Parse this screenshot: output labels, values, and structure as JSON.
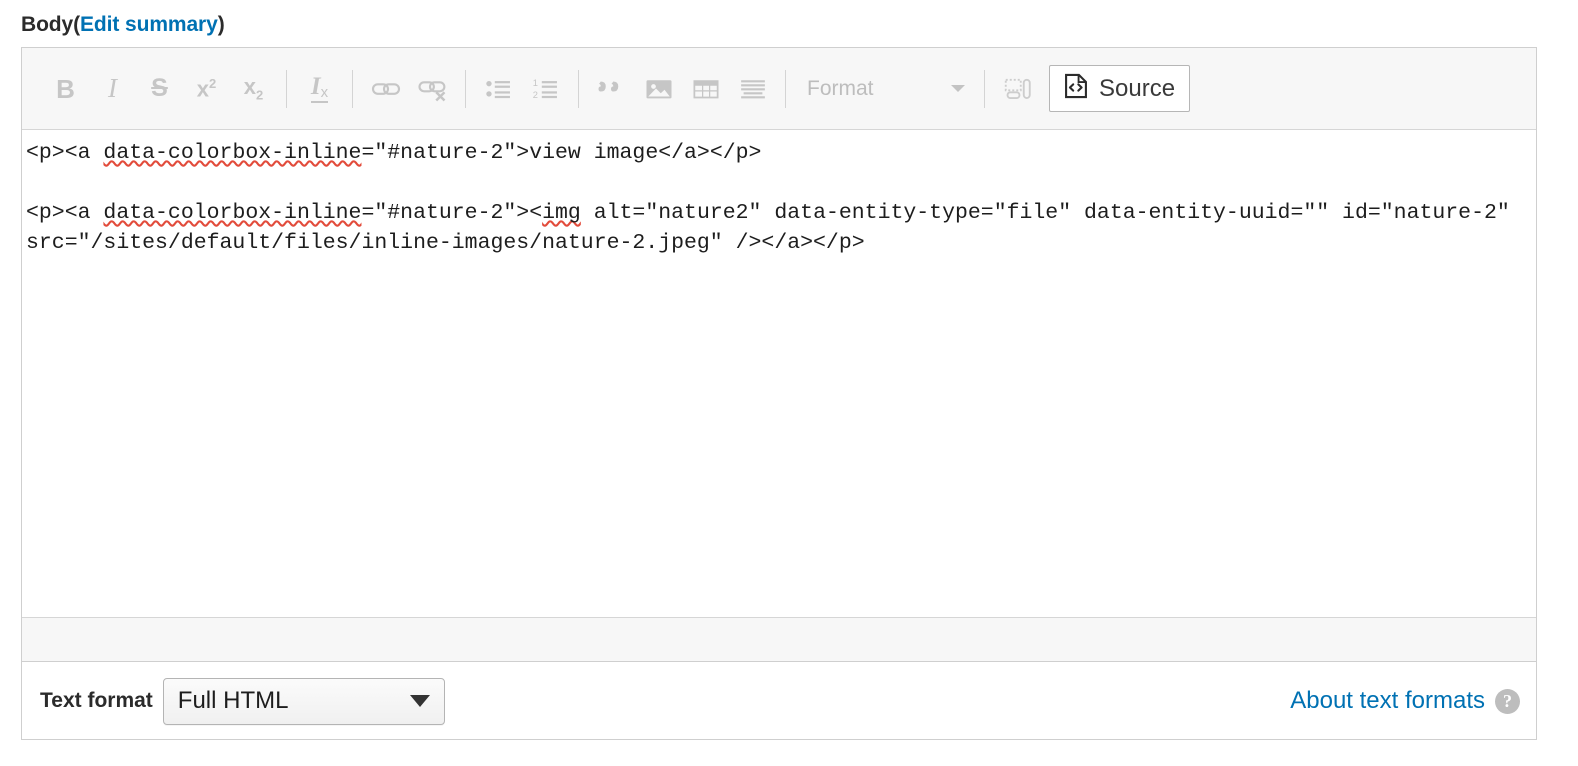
{
  "field": {
    "label_prefix": "Body",
    "paren_open": "(",
    "edit_summary_link": "Edit summary",
    "paren_close": ")"
  },
  "toolbar": {
    "buttons": [
      {
        "name": "bold",
        "label": "B",
        "icon": "bold-icon"
      },
      {
        "name": "italic",
        "label": "I",
        "icon": "italic-icon"
      },
      {
        "name": "strikethrough",
        "label": "S",
        "icon": "strikethrough-icon"
      },
      {
        "name": "superscript",
        "label": "x",
        "sup": "2",
        "icon": "superscript-icon"
      },
      {
        "name": "subscript",
        "label": "x",
        "sub": "2",
        "icon": "subscript-icon"
      },
      {
        "name": "remove-format",
        "label": "I",
        "sub": "x",
        "icon": "remove-format-icon"
      },
      {
        "name": "link",
        "label": "",
        "icon": "link-icon"
      },
      {
        "name": "unlink",
        "label": "",
        "icon": "unlink-icon"
      },
      {
        "name": "bulleted-list",
        "label": "",
        "icon": "bulleted-list-icon"
      },
      {
        "name": "numbered-list",
        "label": "",
        "icon": "numbered-list-icon"
      },
      {
        "name": "blockquote",
        "label": "",
        "icon": "blockquote-icon"
      },
      {
        "name": "image",
        "label": "",
        "icon": "image-icon"
      },
      {
        "name": "table",
        "label": "",
        "icon": "table-icon"
      },
      {
        "name": "horizontal-rule",
        "label": "",
        "icon": "horizontal-rule-icon"
      },
      {
        "name": "templates",
        "label": "",
        "icon": "templates-icon"
      }
    ],
    "format_dropdown": {
      "label": "Format",
      "selected": ""
    },
    "source_button": {
      "label": "Source",
      "active": true
    }
  },
  "source_editor": {
    "line1": "<p><a ",
    "line1_spell": "data-colorbox-inline",
    "line1_rest": "=\"#nature-2\">view image</a></p>",
    "blank": "",
    "line2a": "<p><a ",
    "line2_spell1": "data-colorbox-inline",
    "line2b": "=\"#nature-2\"><",
    "line2_spell2": "img",
    "line2c": " alt=\"nature2\" data-entity-type=\"file\" data-entity-uuid=\"\" id=\"nature-2\" src=\"/sites/default/files/inline-images/nature-2.jpeg\" /></a></p>",
    "full_text": "<p><a data-colorbox-inline=\"#nature-2\">view image</a></p>\n\n<p><a data-colorbox-inline=\"#nature-2\"><img alt=\"nature2\" data-entity-type=\"file\" data-entity-uuid=\"\" id=\"nature-2\" src=\"/sites/default/files/inline-images/nature-2.jpeg\" /></a></p>"
  },
  "text_format": {
    "label": "Text format",
    "selected": "Full HTML",
    "options": [
      "Full HTML"
    ],
    "about_link": "About text formats",
    "help_icon_glyph": "?"
  },
  "colors": {
    "link": "#0071b3",
    "toolbar_bg": "#f7f7f7",
    "border": "#cfcfcf",
    "icon_gray": "#c6c6c6",
    "spellcheck_red": "#e24b3b",
    "text": "#1d1d1d"
  }
}
